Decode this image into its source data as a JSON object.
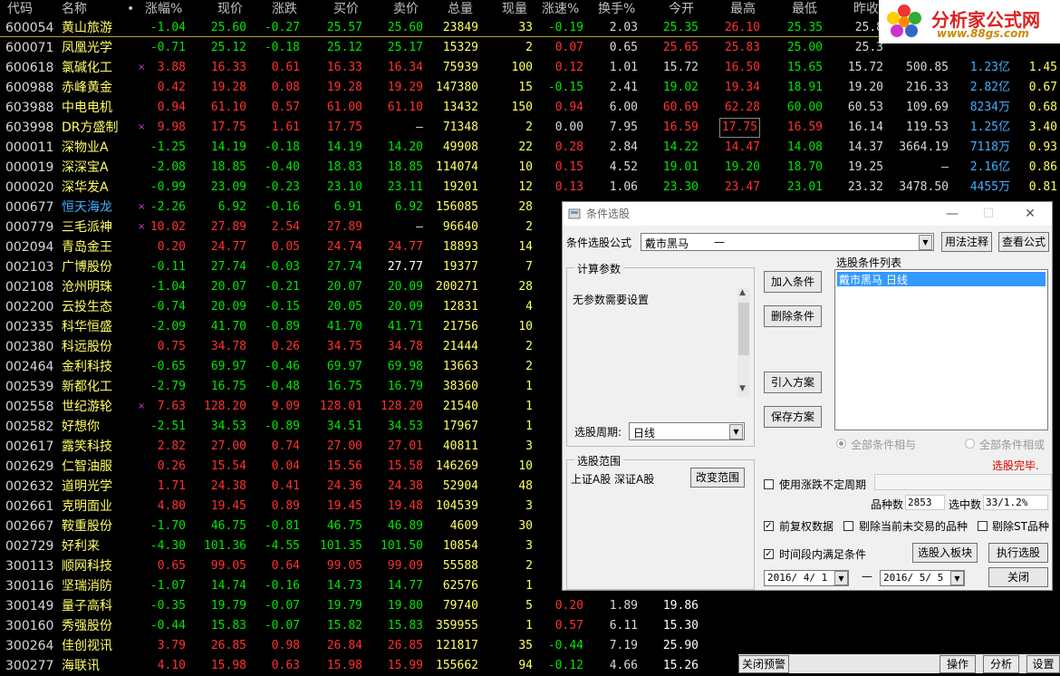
{
  "columns": [
    "代码",
    "名称",
    "•",
    "涨幅%",
    "现价",
    "涨跌",
    "买价",
    "卖价",
    "总量",
    "现量",
    "涨速%",
    "换手%",
    "今开",
    "最高",
    "最低",
    "昨收",
    "",
    "",
    ""
  ],
  "rows": [
    {
      "code": "600054",
      "name": "黄山旅游",
      "mark": "",
      "chg": "-1.04",
      "price": "25.60",
      "diff": "-0.27",
      "bid": "25.57",
      "ask": "25.60",
      "vol": "23849",
      "cur": "33",
      "speed": "-0.19",
      "turn": "2.03",
      "open": "25.35",
      "high": "26.10",
      "low": "25.35",
      "prev": "25.8",
      "c16": "",
      "c17": "",
      "c18": ""
    },
    {
      "code": "600071",
      "name": "凤凰光学",
      "mark": "",
      "chg": "-0.71",
      "price": "25.12",
      "diff": "-0.18",
      "bid": "25.12",
      "ask": "25.17",
      "vol": "15329",
      "cur": "2",
      "speed": "0.07",
      "turn": "0.65",
      "open": "25.65",
      "high": "25.83",
      "low": "25.00",
      "prev": "25.3",
      "c16": "",
      "c17": "",
      "c18": ""
    },
    {
      "code": "600618",
      "name": "氯碱化工",
      "mark": "×",
      "chg": "3.88",
      "price": "16.33",
      "diff": "0.61",
      "bid": "16.33",
      "ask": "16.34",
      "vol": "75939",
      "cur": "100",
      "speed": "0.12",
      "turn": "1.01",
      "open": "15.72",
      "high": "16.50",
      "low": "15.65",
      "prev": "15.72",
      "c16": "500.85",
      "c17": "1.23亿",
      "c18": "1.45"
    },
    {
      "code": "600988",
      "name": "赤峰黄金",
      "mark": "",
      "chg": "0.42",
      "price": "19.28",
      "diff": "0.08",
      "bid": "19.28",
      "ask": "19.29",
      "vol": "147380",
      "cur": "15",
      "speed": "-0.15",
      "turn": "2.41",
      "open": "19.02",
      "high": "19.34",
      "low": "18.91",
      "prev": "19.20",
      "c16": "216.33",
      "c17": "2.82亿",
      "c18": "0.67"
    },
    {
      "code": "603988",
      "name": "中电电机",
      "mark": "",
      "chg": "0.94",
      "price": "61.10",
      "diff": "0.57",
      "bid": "61.00",
      "ask": "61.10",
      "vol": "13432",
      "cur": "150",
      "speed": "0.94",
      "turn": "6.00",
      "open": "60.69",
      "high": "62.28",
      "low": "60.00",
      "prev": "60.53",
      "c16": "109.69",
      "c17": "8234万",
      "c18": "0.68"
    },
    {
      "code": "603998",
      "name": "DR方盛制",
      "mark": "×",
      "chg": "9.98",
      "price": "17.75",
      "diff": "1.61",
      "bid": "17.75",
      "ask": "—",
      "vol": "71348",
      "cur": "2",
      "speed": "0.00",
      "turn": "7.95",
      "open": "16.59",
      "high": "17.75",
      "low": "16.59",
      "prev": "16.14",
      "c16": "119.53",
      "c17": "1.25亿",
      "c18": "3.40"
    },
    {
      "code": "000011",
      "name": "深物业A",
      "mark": "",
      "chg": "-1.25",
      "price": "14.19",
      "diff": "-0.18",
      "bid": "14.19",
      "ask": "14.20",
      "vol": "49908",
      "cur": "22",
      "speed": "0.28",
      "turn": "2.84",
      "open": "14.22",
      "high": "14.47",
      "low": "14.08",
      "prev": "14.37",
      "c16": "3664.19",
      "c17": "7118万",
      "c18": "0.93"
    },
    {
      "code": "000019",
      "name": "深深宝A",
      "mark": "",
      "chg": "-2.08",
      "price": "18.85",
      "diff": "-0.40",
      "bid": "18.83",
      "ask": "18.85",
      "vol": "114074",
      "cur": "10",
      "speed": "0.15",
      "turn": "4.52",
      "open": "19.01",
      "high": "19.20",
      "low": "18.70",
      "prev": "19.25",
      "c16": "—",
      "c17": "2.16亿",
      "c18": "0.86"
    },
    {
      "code": "000020",
      "name": "深华发A",
      "mark": "",
      "chg": "-0.99",
      "price": "23.09",
      "diff": "-0.23",
      "bid": "23.10",
      "ask": "23.11",
      "vol": "19201",
      "cur": "12",
      "speed": "0.13",
      "turn": "1.06",
      "open": "23.30",
      "high": "23.47",
      "low": "23.01",
      "prev": "23.32",
      "c16": "3478.50",
      "c17": "4455万",
      "c18": "0.81"
    },
    {
      "code": "000677",
      "name": "恒天海龙",
      "mark": "×",
      "chg": "-2.26",
      "price": "6.92",
      "diff": "-0.16",
      "bid": "6.91",
      "ask": "6.92",
      "vol": "156085",
      "cur": "28",
      "speed": "",
      "turn": "",
      "open": "",
      "high": "",
      "low": "",
      "prev": "",
      "c16": "",
      "c17": "",
      "c18": ""
    },
    {
      "code": "000779",
      "name": "三毛派神",
      "mark": "×",
      "chg": "10.02",
      "price": "27.89",
      "diff": "2.54",
      "bid": "27.89",
      "ask": "—",
      "vol": "96640",
      "cur": "2",
      "speed": "",
      "turn": "",
      "open": "",
      "high": "",
      "low": "",
      "prev": "",
      "c16": "",
      "c17": "",
      "c18": ""
    },
    {
      "code": "002094",
      "name": "青岛金王",
      "mark": "",
      "chg": "0.20",
      "price": "24.77",
      "diff": "0.05",
      "bid": "24.74",
      "ask": "24.77",
      "vol": "18893",
      "cur": "14",
      "speed": "",
      "turn": "",
      "open": "",
      "high": "",
      "low": "",
      "prev": "",
      "c16": "",
      "c17": "",
      "c18": ""
    },
    {
      "code": "002103",
      "name": "广博股份",
      "mark": "",
      "chg": "-0.11",
      "price": "27.74",
      "diff": "-0.03",
      "bid": "27.74",
      "ask": "27.77",
      "vol": "19377",
      "cur": "7",
      "speed": "",
      "turn": "",
      "open": "",
      "high": "",
      "low": "",
      "prev": "",
      "c16": "",
      "c17": "",
      "c18": ""
    },
    {
      "code": "002108",
      "name": "沧州明珠",
      "mark": "",
      "chg": "-1.04",
      "price": "20.07",
      "diff": "-0.21",
      "bid": "20.07",
      "ask": "20.09",
      "vol": "200271",
      "cur": "28",
      "speed": "",
      "turn": "",
      "open": "",
      "high": "",
      "low": "",
      "prev": "",
      "c16": "",
      "c17": "",
      "c18": ""
    },
    {
      "code": "002200",
      "name": "云投生态",
      "mark": "",
      "chg": "-0.74",
      "price": "20.09",
      "diff": "-0.15",
      "bid": "20.05",
      "ask": "20.09",
      "vol": "12831",
      "cur": "4",
      "speed": "",
      "turn": "",
      "open": "",
      "high": "",
      "low": "",
      "prev": "",
      "c16": "",
      "c17": "",
      "c18": ""
    },
    {
      "code": "002335",
      "name": "科华恒盛",
      "mark": "",
      "chg": "-2.09",
      "price": "41.70",
      "diff": "-0.89",
      "bid": "41.70",
      "ask": "41.71",
      "vol": "21756",
      "cur": "10",
      "speed": "",
      "turn": "",
      "open": "",
      "high": "",
      "low": "",
      "prev": "",
      "c16": "",
      "c17": "",
      "c18": ""
    },
    {
      "code": "002380",
      "name": "科远股份",
      "mark": "",
      "chg": "0.75",
      "price": "34.78",
      "diff": "0.26",
      "bid": "34.75",
      "ask": "34.78",
      "vol": "21444",
      "cur": "2",
      "speed": "",
      "turn": "",
      "open": "",
      "high": "",
      "low": "",
      "prev": "",
      "c16": "",
      "c17": "",
      "c18": ""
    },
    {
      "code": "002464",
      "name": "金利科技",
      "mark": "",
      "chg": "-0.65",
      "price": "69.97",
      "diff": "-0.46",
      "bid": "69.97",
      "ask": "69.98",
      "vol": "13663",
      "cur": "2",
      "speed": "",
      "turn": "",
      "open": "",
      "high": "",
      "low": "",
      "prev": "",
      "c16": "",
      "c17": "",
      "c18": ""
    },
    {
      "code": "002539",
      "name": "新都化工",
      "mark": "",
      "chg": "-2.79",
      "price": "16.75",
      "diff": "-0.48",
      "bid": "16.75",
      "ask": "16.79",
      "vol": "38360",
      "cur": "1",
      "speed": "",
      "turn": "",
      "open": "",
      "high": "",
      "low": "",
      "prev": "",
      "c16": "",
      "c17": "",
      "c18": ""
    },
    {
      "code": "002558",
      "name": "世纪游轮",
      "mark": "×",
      "chg": "7.63",
      "price": "128.20",
      "diff": "9.09",
      "bid": "128.01",
      "ask": "128.20",
      "vol": "21540",
      "cur": "1",
      "speed": "",
      "turn": "",
      "open": "",
      "high": "",
      "low": "",
      "prev": "",
      "c16": "",
      "c17": "",
      "c18": ""
    },
    {
      "code": "002582",
      "name": "好想你",
      "mark": "",
      "chg": "-2.51",
      "price": "34.53",
      "diff": "-0.89",
      "bid": "34.51",
      "ask": "34.53",
      "vol": "17967",
      "cur": "1",
      "speed": "",
      "turn": "",
      "open": "",
      "high": "",
      "low": "",
      "prev": "",
      "c16": "",
      "c17": "",
      "c18": ""
    },
    {
      "code": "002617",
      "name": "露笑科技",
      "mark": "",
      "chg": "2.82",
      "price": "27.00",
      "diff": "0.74",
      "bid": "27.00",
      "ask": "27.01",
      "vol": "40811",
      "cur": "3",
      "speed": "",
      "turn": "",
      "open": "",
      "high": "",
      "low": "",
      "prev": "",
      "c16": "",
      "c17": "",
      "c18": ""
    },
    {
      "code": "002629",
      "name": "仁智油服",
      "mark": "",
      "chg": "0.26",
      "price": "15.54",
      "diff": "0.04",
      "bid": "15.56",
      "ask": "15.58",
      "vol": "146269",
      "cur": "10",
      "speed": "",
      "turn": "",
      "open": "",
      "high": "",
      "low": "",
      "prev": "",
      "c16": "",
      "c17": "",
      "c18": ""
    },
    {
      "code": "002632",
      "name": "道明光学",
      "mark": "",
      "chg": "1.71",
      "price": "24.38",
      "diff": "0.41",
      "bid": "24.36",
      "ask": "24.38",
      "vol": "52904",
      "cur": "48",
      "speed": "",
      "turn": "",
      "open": "",
      "high": "",
      "low": "",
      "prev": "",
      "c16": "",
      "c17": "",
      "c18": ""
    },
    {
      "code": "002661",
      "name": "克明面业",
      "mark": "",
      "chg": "4.80",
      "price": "19.45",
      "diff": "0.89",
      "bid": "19.45",
      "ask": "19.48",
      "vol": "104539",
      "cur": "3",
      "speed": "",
      "turn": "",
      "open": "",
      "high": "",
      "low": "",
      "prev": "",
      "c16": "",
      "c17": "",
      "c18": ""
    },
    {
      "code": "002667",
      "name": "鞍重股份",
      "mark": "",
      "chg": "-1.70",
      "price": "46.75",
      "diff": "-0.81",
      "bid": "46.75",
      "ask": "46.89",
      "vol": "4609",
      "cur": "30",
      "speed": "",
      "turn": "",
      "open": "",
      "high": "",
      "low": "",
      "prev": "",
      "c16": "",
      "c17": "",
      "c18": ""
    },
    {
      "code": "002729",
      "name": "好利来",
      "mark": "",
      "chg": "-4.30",
      "price": "101.36",
      "diff": "-4.55",
      "bid": "101.35",
      "ask": "101.50",
      "vol": "10854",
      "cur": "3",
      "speed": "",
      "turn": "",
      "open": "",
      "high": "",
      "low": "",
      "prev": "",
      "c16": "",
      "c17": "",
      "c18": ""
    },
    {
      "code": "300113",
      "name": "顺网科技",
      "mark": "",
      "chg": "0.65",
      "price": "99.05",
      "diff": "0.64",
      "bid": "99.05",
      "ask": "99.09",
      "vol": "55588",
      "cur": "2",
      "speed": "",
      "turn": "",
      "open": "",
      "high": "",
      "low": "",
      "prev": "",
      "c16": "",
      "c17": "",
      "c18": ""
    },
    {
      "code": "300116",
      "name": "坚瑞消防",
      "mark": "",
      "chg": "-1.07",
      "price": "14.74",
      "diff": "-0.16",
      "bid": "14.73",
      "ask": "14.77",
      "vol": "62576",
      "cur": "1",
      "speed": "",
      "turn": "",
      "open": "",
      "high": "",
      "low": "",
      "prev": "",
      "c16": "",
      "c17": "",
      "c18": ""
    },
    {
      "code": "300149",
      "name": "量子高科",
      "mark": "",
      "chg": "-0.35",
      "price": "19.79",
      "diff": "-0.07",
      "bid": "19.79",
      "ask": "19.80",
      "vol": "79740",
      "cur": "5",
      "speed": "0.20",
      "turn": "1.89",
      "open": "19.86",
      "high": "",
      "low": "",
      "prev": "",
      "c16": "",
      "c17": "",
      "c18": ""
    },
    {
      "code": "300160",
      "name": "秀强股份",
      "mark": "",
      "chg": "-0.44",
      "price": "15.83",
      "diff": "-0.07",
      "bid": "15.82",
      "ask": "15.83",
      "vol": "359955",
      "cur": "1",
      "speed": "0.57",
      "turn": "6.11",
      "open": "15.30",
      "high": "",
      "low": "",
      "prev": "",
      "c16": "",
      "c17": "",
      "c18": ""
    },
    {
      "code": "300264",
      "name": "佳创视讯",
      "mark": "",
      "chg": "3.79",
      "price": "26.85",
      "diff": "0.98",
      "bid": "26.84",
      "ask": "26.85",
      "vol": "121817",
      "cur": "35",
      "speed": "-0.44",
      "turn": "7.19",
      "open": "25.90",
      "high": "",
      "low": "",
      "prev": "",
      "c16": "",
      "c17": "",
      "c18": ""
    },
    {
      "code": "300277",
      "name": "海联讯",
      "mark": "",
      "chg": "4.10",
      "price": "15.98",
      "diff": "0.63",
      "bid": "15.98",
      "ask": "15.99",
      "vol": "155662",
      "cur": "94",
      "speed": "-0.12",
      "turn": "4.66",
      "open": "15.26",
      "high": "",
      "low": "",
      "prev": "",
      "c16": "",
      "c17": "",
      "c18": ""
    }
  ],
  "logo": {
    "title": "分析家公式网",
    "url": "www.88gs.com"
  },
  "colors": {
    "up": "#ff3232",
    "down": "#00e600",
    "neutral": "#d8d8d8",
    "name": "#ffff66",
    "code": "#d8d8d8",
    "mark": "#d040d0",
    "link": "#40b0ff"
  },
  "dialog": {
    "title": "条件选股",
    "formula_label": "条件选股公式",
    "formula_value": "戴市黑马",
    "formula_suffix": "—",
    "btn_usage": "用法注释",
    "btn_view": "查看公式",
    "calc_params_label": "计算参数",
    "no_params": "无参数需要设置",
    "period_label": "选股周期:",
    "period_value": "日线",
    "scope_label": "选股范围",
    "scope_value": "上证A股  深证A股",
    "btn_change_scope": "改变范围",
    "btn_add": "加入条件",
    "btn_del": "删除条件",
    "btn_import": "引入方案",
    "btn_save": "保存方案",
    "cond_list_label": "选股条件列表",
    "cond_item": "戴市黑马   日线",
    "radio_and": "全部条件相与",
    "radio_or": "全部条件相或",
    "status": "选股完毕.",
    "chk_variable": "使用涨跌不定周期",
    "count_label": "品种数",
    "count_value": "2853",
    "selected_label": "选中数",
    "selected_value": "33/1.2%",
    "chk_prev_adj": "前复权数据",
    "chk_exclude_untraded": "剔除当前未交易的品种",
    "chk_exclude_st": "剔除ST品种",
    "chk_period_satisfy": "时间段内满足条件",
    "btn_to_block": "选股入板块",
    "btn_exec": "执行选股",
    "date_from": "2016/ 4/ 1",
    "date_to": "2016/ 5/ 5",
    "btn_close": "关闭"
  },
  "bottom": {
    "close_alert": "关闭预警",
    "ops": "操作",
    "analysis": "分析",
    "settings": "设置"
  }
}
